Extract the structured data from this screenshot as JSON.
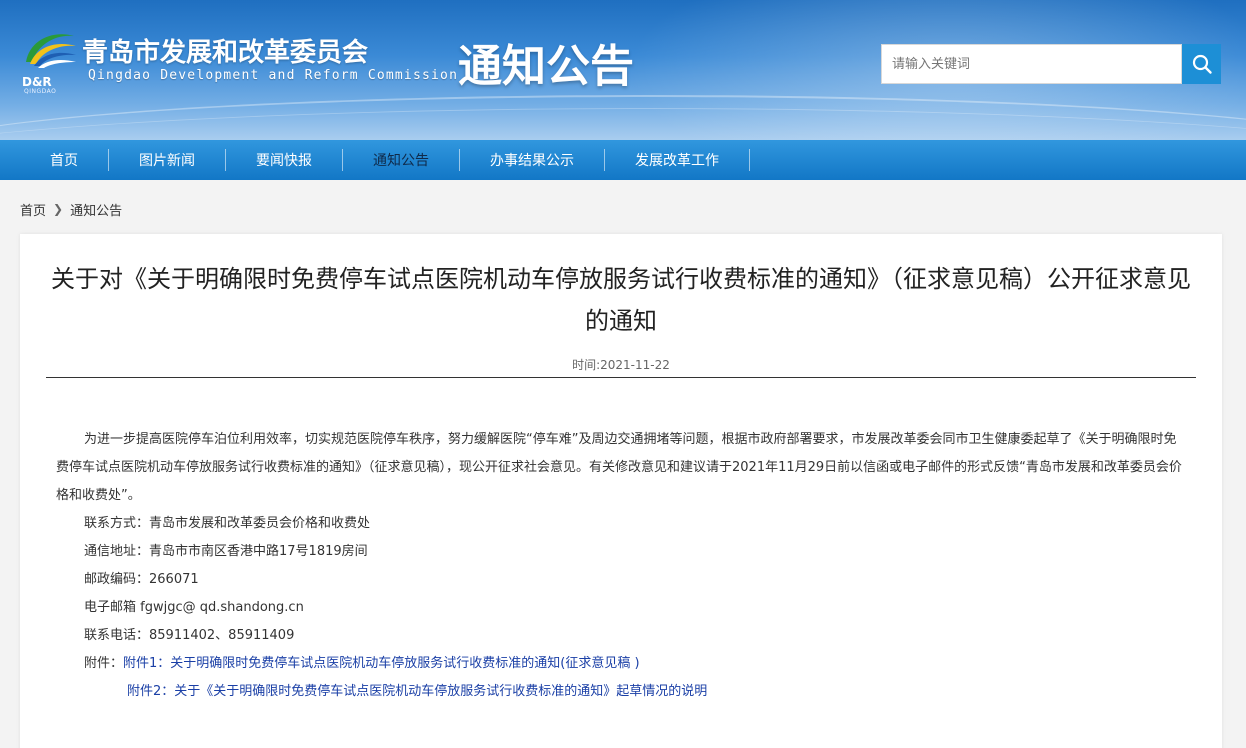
{
  "header": {
    "logo_text": "D&R",
    "logo_sub": "QINGDAO",
    "org_name": "青岛市发展和改革委员会",
    "org_name_en": "Qingdao Development and Reform Commission",
    "section_title": "通知公告",
    "search_placeholder": "请输入关键词"
  },
  "nav": {
    "items": [
      {
        "label": "首页"
      },
      {
        "label": "图片新闻"
      },
      {
        "label": "要闻快报"
      },
      {
        "label": "通知公告"
      },
      {
        "label": "办事结果公示"
      },
      {
        "label": "发展改革工作"
      }
    ],
    "active": "通知公告"
  },
  "breadcrumb": {
    "home": "首页",
    "current": "通知公告"
  },
  "article": {
    "title": "关于对《关于明确限时免费停车试点医院机动车停放服务试行收费标准的通知》（征求意见稿）公开征求意见的通知",
    "date": "时间:2021-11-22",
    "paragraph": "为进一步提高医院停车泊位利用效率，切实规范医院停车秩序，努力缓解医院“停车难”及周边交通拥堵等问题，根据市政府部署要求，市发展改革委会同市卫生健康委起草了《关于明确限时免费停车试点医院机动车停放服务试行收费标准的通知》（征求意见稿），现公开征求社会意见。有关修改意见和建议请于2021年11月29日前以信函或电子邮件的形式反馈“青岛市发展和改革委员会价格和收费处”。",
    "contact": "联系方式：青岛市发展和改革委员会价格和收费处",
    "address": "通信地址：青岛市市南区香港中路17号1819房间",
    "postcode": "邮政编码：266071",
    "email": "电子邮箱  fgwjgc@ qd.shandong.cn",
    "phone": "联系电话：85911402、85911409",
    "attach_label": "附件：",
    "attachment1": "附件1：关于明确限时免费停车试点医院机动车停放服务试行收费标准的通知(征求意见稿 )",
    "attachment2": "附件2：关于《关于明确限时免费停车试点医院机动车停放服务试行收费标准的通知》起草情况的说明"
  }
}
